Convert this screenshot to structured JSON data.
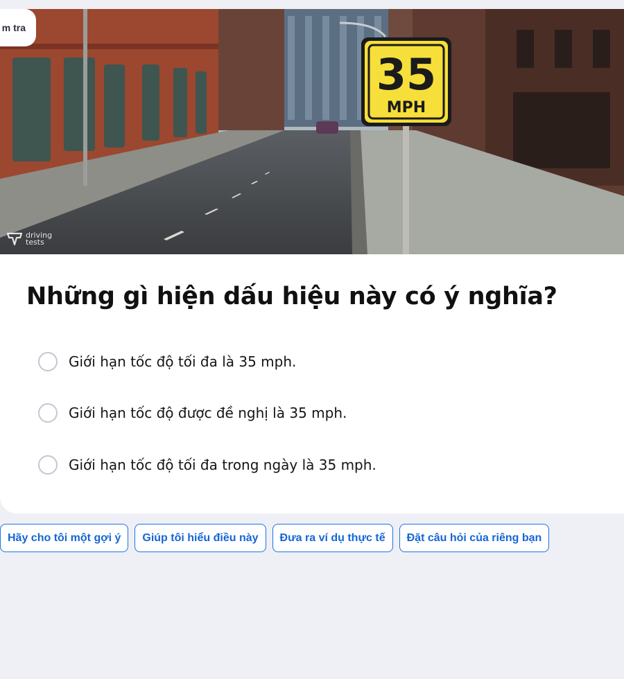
{
  "header": {
    "check_tab_label": "m tra"
  },
  "hero": {
    "sign_number": "35",
    "sign_unit": "MPH",
    "watermark_line1": "driving",
    "watermark_line2": "tests"
  },
  "quiz": {
    "question": "Những gì hiện dấu hiệu này có ý nghĩa?",
    "options": [
      {
        "label": "Giới hạn tốc độ tối đa là 35 mph."
      },
      {
        "label": "Giới hạn tốc độ được đề nghị là 35 mph."
      },
      {
        "label": "Giới hạn tốc độ tối đa trong ngày là 35 mph."
      }
    ]
  },
  "help_chips": [
    {
      "label": "Hãy cho tôi một gợi ý"
    },
    {
      "label": "Giúp tôi hiểu điều này"
    },
    {
      "label": "Đưa ra ví dụ thực tế"
    },
    {
      "label": "Đặt câu hỏi của riêng bạn"
    }
  ],
  "colors": {
    "accent": "#1a73e8",
    "background": "#eff0f5",
    "sign_yellow": "#f6df3a"
  }
}
